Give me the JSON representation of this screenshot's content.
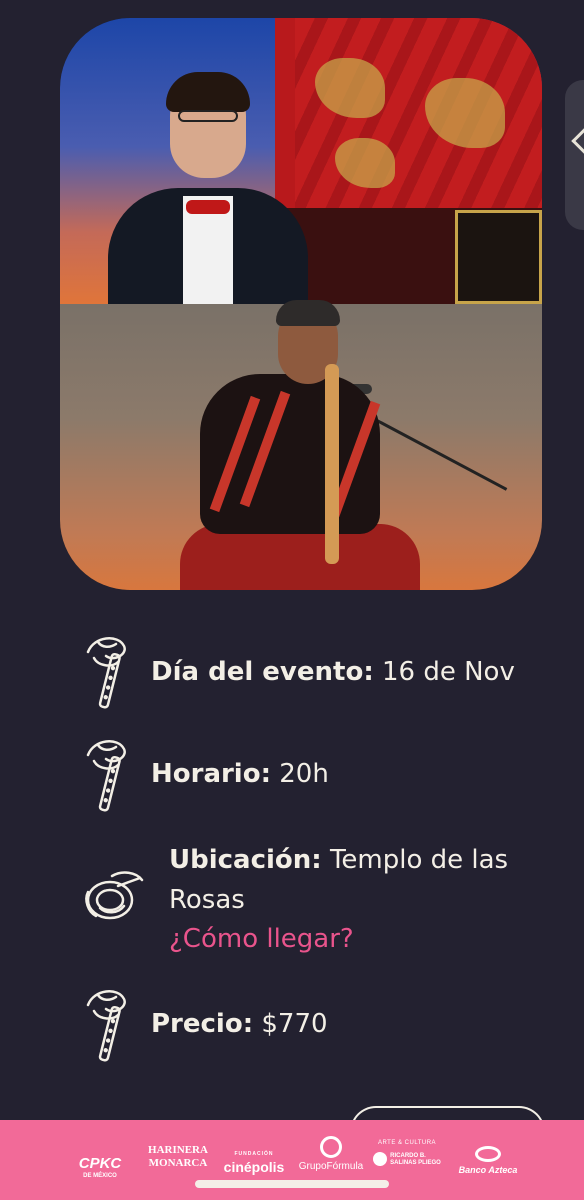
{
  "event": {
    "date_label": "Día del evento:",
    "date_value": "16 de Nov",
    "time_label": "Horario:",
    "time_value": "20h",
    "location_label": "Ubicación:",
    "location_value_line1": "Templo de las",
    "location_value_line2": "Rosas",
    "directions_link": "¿Cómo llegar?",
    "price_label": "Precio:",
    "price_value": "$770"
  },
  "icons": {
    "date": "flute-icon",
    "time": "flute-icon",
    "location": "french-horn-icon",
    "price": "flute-icon",
    "side_nav": "chevron-left-icon"
  },
  "sponsors": {
    "cpkc": "CPKC",
    "cpkc_sub": "DE MÉXICO",
    "harinera_line1": "HARINERA",
    "harinera_line2": "MONARCA",
    "cinepolis_top": "FUNDACIÓN",
    "cinepolis": "cinépolis",
    "grupo_formula": "GrupoFórmula",
    "arte_cultura": "ARTE & CULTURA",
    "ricardo_line1": "RICARDO B.",
    "ricardo_line2": "SALINAS PLIEGO",
    "banco_azteca": "Banco Azteca"
  },
  "colors": {
    "background": "#232130",
    "accent_link": "#e9548c",
    "footer": "#f26a98",
    "text": "#f3efe6"
  }
}
